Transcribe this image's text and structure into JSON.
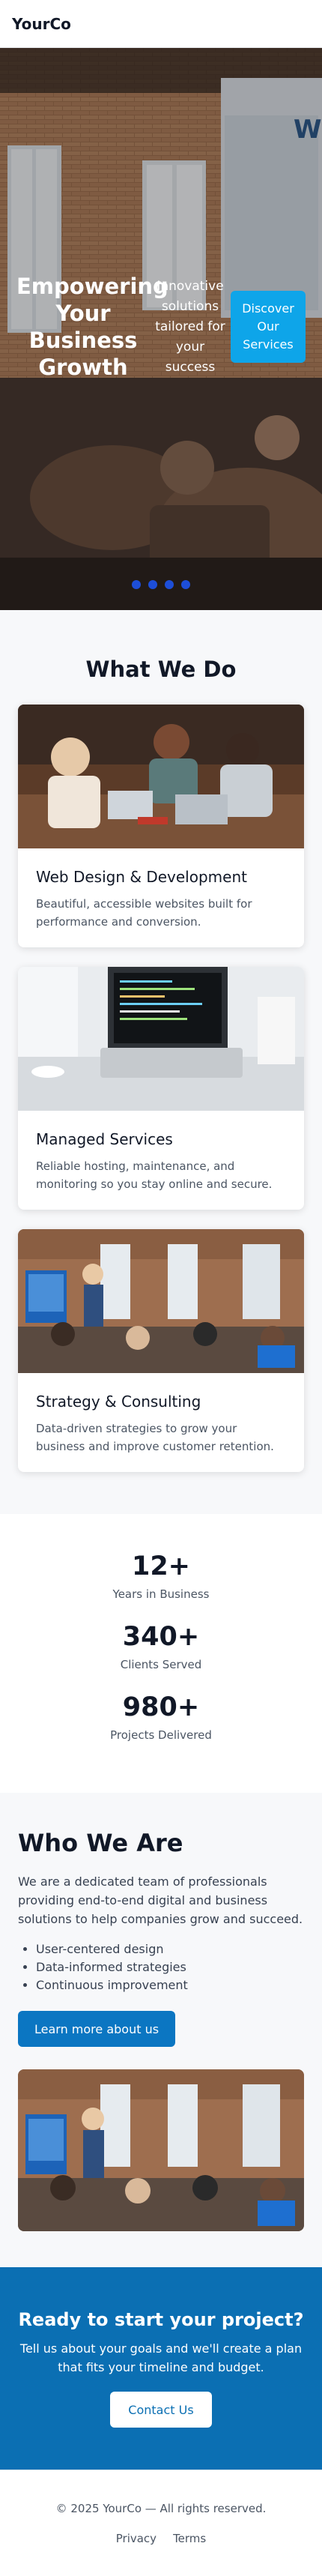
{
  "header": {
    "brand": "YourCo"
  },
  "hero": {
    "title": "Empowering Your Business Growth",
    "subtitle": "Innovative solutions tailored for your success",
    "cta_label": "Discover Our Services",
    "slides": 4
  },
  "services": {
    "title": "What We Do",
    "items": [
      {
        "title": "Web Design & Development",
        "text": "Beautiful, accessible websites built for performance and conversion."
      },
      {
        "title": "Managed Services",
        "text": "Reliable hosting, maintenance, and monitoring so you stay online and secure."
      },
      {
        "title": "Strategy & Consulting",
        "text": "Data-driven strategies to grow your business and improve customer retention."
      }
    ]
  },
  "stats": [
    {
      "value": "12+",
      "label": "Years in Business"
    },
    {
      "value": "340+",
      "label": "Clients Served"
    },
    {
      "value": "980+",
      "label": "Projects Delivered"
    }
  ],
  "about": {
    "title": "Who We Are",
    "text": "We are a dedicated team of professionals providing end-to-end digital and business solutions to help companies grow and succeed.",
    "bullets": [
      "User-centered design",
      "Data-informed strategies",
      "Continuous improvement"
    ],
    "button_label": "Learn more about us"
  },
  "cta": {
    "title": "Ready to start your project?",
    "text": "Tell us about your goals and we'll create a plan that fits your timeline and budget.",
    "button_label": "Contact Us"
  },
  "footer": {
    "copyright": "© 2025 YourCo — All rights reserved.",
    "links": [
      "Privacy",
      "Terms"
    ]
  },
  "colors": {
    "accent": "#0ea5e9",
    "primary": "#0b76c2",
    "cta_bg": "#0b6fb3",
    "dot": "#1d4ed8"
  }
}
